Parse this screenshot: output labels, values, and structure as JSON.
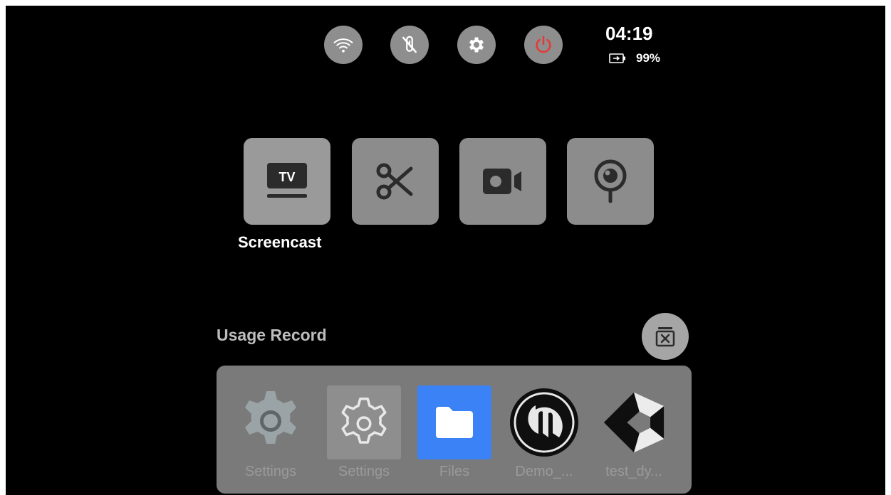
{
  "status": {
    "time": "04:19",
    "battery": "99%"
  },
  "quick_settings": [
    {
      "icon": "wifi-icon"
    },
    {
      "icon": "no-touch-icon"
    },
    {
      "icon": "gear-icon"
    },
    {
      "icon": "power-icon",
      "color": "#e53935"
    }
  ],
  "tools": [
    {
      "icon": "tv-icon",
      "label": "Screencast",
      "selected": true
    },
    {
      "icon": "scissors-icon"
    },
    {
      "icon": "video-camera-icon"
    },
    {
      "icon": "webcam-icon"
    }
  ],
  "usage": {
    "title": "Usage Record",
    "clear_icon": "clear-all-icon",
    "apps": [
      {
        "icon": "settings-gear-icon",
        "label": "Settings"
      },
      {
        "icon": "settings-outline-icon",
        "label": "Settings"
      },
      {
        "icon": "folder-icon",
        "label": "Files",
        "color": "#3b82f6"
      },
      {
        "icon": "unreal-logo-icon",
        "label": "Demo_..."
      },
      {
        "icon": "unity-logo-icon",
        "label": "test_dy..."
      }
    ]
  }
}
